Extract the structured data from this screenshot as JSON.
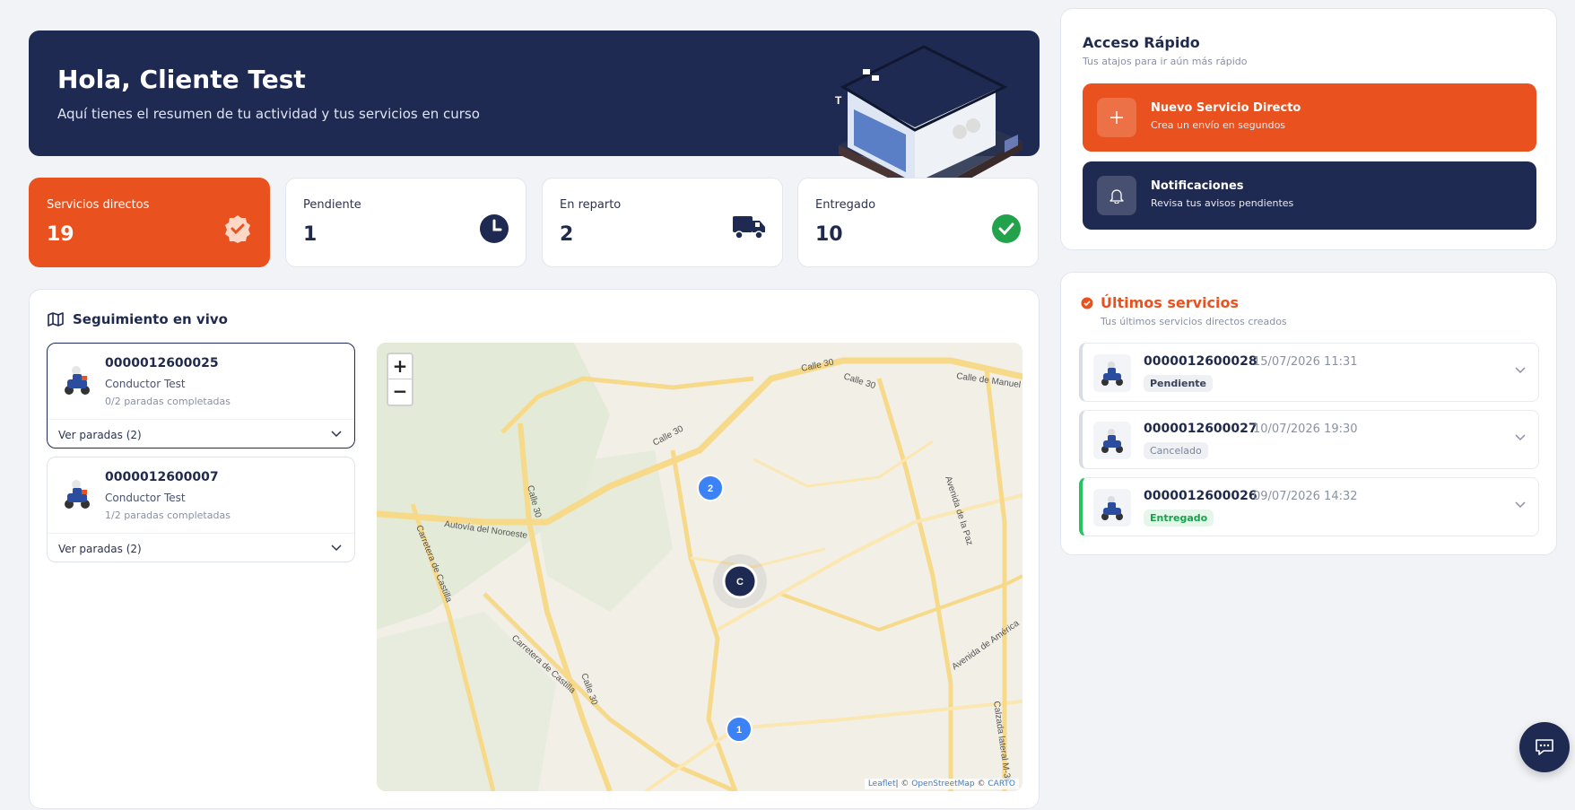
{
  "hero": {
    "title": "Hola, Cliente Test",
    "subtitle": "Aquí tienes el resumen de tu actividad y tus servicios en curso"
  },
  "stats": [
    {
      "label": "Servicios directos",
      "value": "19",
      "icon": "check-badge-icon"
    },
    {
      "label": "Pendiente",
      "value": "1",
      "icon": "clock-icon"
    },
    {
      "label": "En reparto",
      "value": "2",
      "icon": "truck-icon"
    },
    {
      "label": "Entregado",
      "value": "10",
      "icon": "check-circle-icon"
    }
  ],
  "tracking": {
    "title": "Seguimiento en vivo",
    "services": [
      {
        "id": "0000012600025",
        "driver": "Conductor Test",
        "stops": "0/2 paradas completadas",
        "toggle": "Ver paradas (2)"
      },
      {
        "id": "0000012600007",
        "driver": "Conductor Test",
        "stops": "1/2 paradas completadas",
        "toggle": "Ver paradas (2)"
      }
    ],
    "map": {
      "zoom_in": "+",
      "zoom_out": "−",
      "markers": [
        "2",
        "C",
        "1"
      ],
      "labels": [
        "Calle 30",
        "Calle 30",
        "Calle de Manuel",
        "Calle 30",
        "Calle 30",
        "Autovía del Noroeste",
        "Carretera de Castilla",
        "Carretera de Castilla",
        "Calle 30",
        "Avenida de la Paz",
        "Avenida de América",
        "Calzada lateral M-30"
      ],
      "attribution_leaflet": "Leaflet",
      "attribution_rest": "| © ",
      "attribution_osm": "OpenStreetMap",
      "attribution_copy": " © ",
      "attribution_carto": "CARTO"
    }
  },
  "quick": {
    "title": "Acceso Rápido",
    "subtitle": "Tus atajos para ir aún más rápido",
    "new_service": {
      "title": "Nuevo Servicio Directo",
      "subtitle": "Crea un envío en segundos"
    },
    "notifications": {
      "title": "Notificaciones",
      "subtitle": "Revisa tus avisos pendientes"
    }
  },
  "latest": {
    "title": "Últimos servicios",
    "subtitle": "Tus últimos servicios directos creados",
    "rows": [
      {
        "id": "0000012600028",
        "date": "15/07/2026 11:31",
        "status": "Pendiente"
      },
      {
        "id": "0000012600027",
        "date": "10/07/2026 19:30",
        "status": "Cancelado"
      },
      {
        "id": "0000012600026",
        "date": "09/07/2026 14:32",
        "status": "Entregado"
      }
    ]
  },
  "colors": {
    "primary": "#1f2a52",
    "accent": "#e9521f",
    "success": "#22c55e"
  }
}
